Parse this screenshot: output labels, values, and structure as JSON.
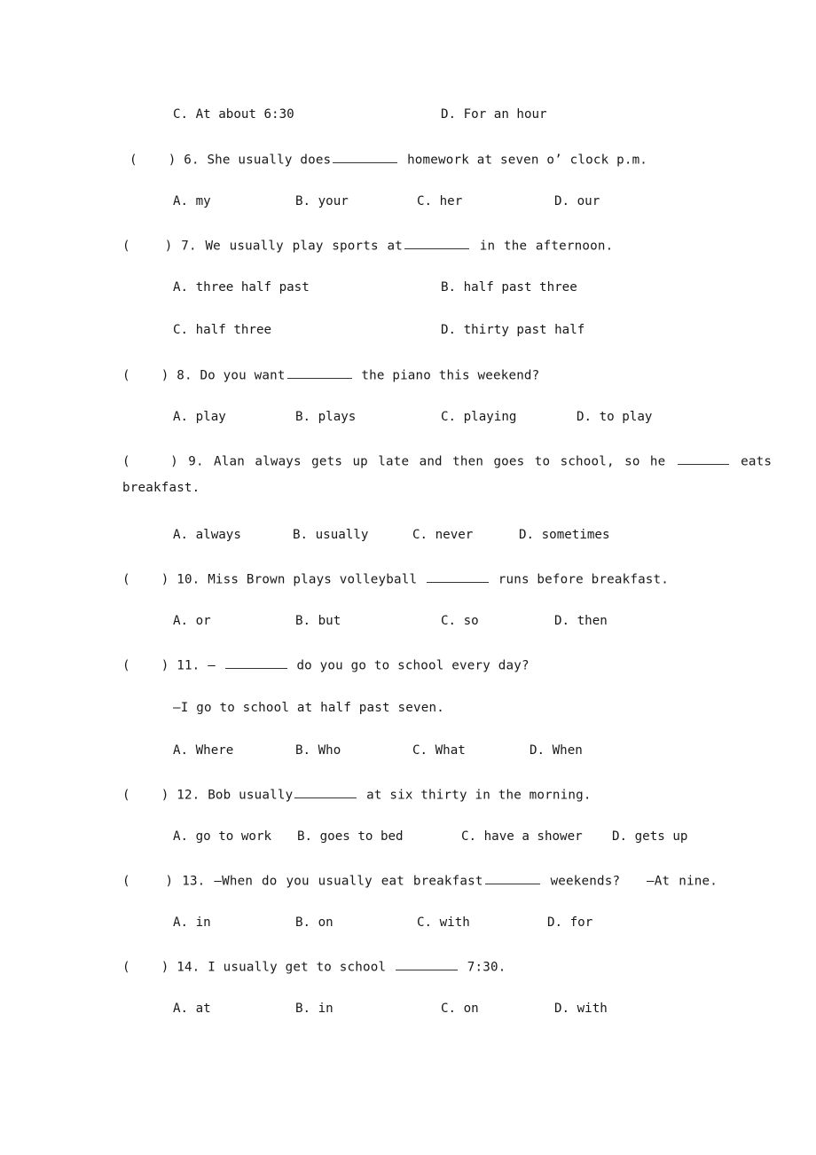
{
  "document": {
    "type": "worksheet",
    "subject": "English grammar multiple-choice exercise",
    "page_background": "#ffffff",
    "text_color": "#181818"
  },
  "orphan_options_top": {
    "c_label": "C.",
    "c_text": "At about 6:30",
    "d_label": "D.",
    "d_text": "For an hour"
  },
  "questions": [
    {
      "marker": "(    )",
      "number": "6.",
      "stem_before": "She usually does",
      "stem_after": "homework at seven o’ clock p.m.",
      "blank_width": "w73",
      "options": [
        {
          "label": "A.",
          "text": "my"
        },
        {
          "label": "B.",
          "text": "your"
        },
        {
          "label": "C.",
          "text": "her"
        },
        {
          "label": "D.",
          "text": "our"
        }
      ]
    },
    {
      "marker": "(    )",
      "number": "7.",
      "stem_before": "We usually play sports at",
      "stem_after": "in the afternoon.",
      "blank_width": "w73",
      "options": [
        {
          "label": "A.",
          "text": "three half past"
        },
        {
          "label": "B.",
          "text": "half past three"
        },
        {
          "label": "C.",
          "text": "half three"
        },
        {
          "label": "D.",
          "text": "thirty past half"
        }
      ]
    },
    {
      "marker": "(    )",
      "number": "8.",
      "stem_before": "Do you want",
      "stem_after": "the piano this weekend?",
      "blank_width": "w73",
      "options": [
        {
          "label": "A.",
          "text": "play"
        },
        {
          "label": "B.",
          "text": "plays"
        },
        {
          "label": "C.",
          "text": "playing"
        },
        {
          "label": "D.",
          "text": "to play"
        }
      ]
    },
    {
      "marker": "(    )",
      "number": "9.",
      "stem_before": "Alan always gets up late and then goes to school, so he",
      "stem_after": "eats",
      "stem_wrap": "breakfast.",
      "blank_width": "w58",
      "options": [
        {
          "label": "A.",
          "text": "always"
        },
        {
          "label": "B.",
          "text": "usually"
        },
        {
          "label": "C.",
          "text": "never"
        },
        {
          "label": "D.",
          "text": "sometimes"
        }
      ]
    },
    {
      "marker": "(    )",
      "number": "10.",
      "stem_before": "Miss Brown plays volleyball",
      "stem_after": "runs before breakfast.",
      "blank_width": "w70",
      "options": [
        {
          "label": "A.",
          "text": "or"
        },
        {
          "label": "B.",
          "text": "but"
        },
        {
          "label": "C.",
          "text": "so"
        },
        {
          "label": "D.",
          "text": "then"
        }
      ]
    },
    {
      "marker": "(    )",
      "number": "11.",
      "stem_before": "—",
      "stem_after": "do you go to school every day?",
      "blank_width": "w70",
      "answer_line": "—I go to school at half past seven.",
      "options": [
        {
          "label": "A.",
          "text": "Where"
        },
        {
          "label": "B.",
          "text": "Who"
        },
        {
          "label": "C.",
          "text": "What"
        },
        {
          "label": "D.",
          "text": "When"
        }
      ]
    },
    {
      "marker": "(    )",
      "number": "12.",
      "stem_before": "Bob usually",
      "stem_after": "at six thirty in the morning.",
      "blank_width": "w70",
      "options": [
        {
          "label": "A.",
          "text": "go to work"
        },
        {
          "label": "B.",
          "text": "goes to bed"
        },
        {
          "label": "C.",
          "text": "have a shower"
        },
        {
          "label": "D.",
          "text": "gets up"
        }
      ]
    },
    {
      "marker": "(    )",
      "number": "13.",
      "stem_before": "—When do you usually eat breakfast",
      "stem_after": "weekends?   —At nine.",
      "blank_width": "w62",
      "options": [
        {
          "label": "A.",
          "text": "in"
        },
        {
          "label": "B.",
          "text": "on"
        },
        {
          "label": "C.",
          "text": "with"
        },
        {
          "label": "D.",
          "text": "for"
        }
      ]
    },
    {
      "marker": "(    )",
      "number": "14.",
      "stem_before": "I usually get to school",
      "stem_after": "7:30.",
      "blank_width": "w70",
      "options": [
        {
          "label": "A.",
          "text": "at"
        },
        {
          "label": "B.",
          "text": "in"
        },
        {
          "label": "C.",
          "text": "on"
        },
        {
          "label": "D.",
          "text": "with"
        }
      ]
    }
  ]
}
